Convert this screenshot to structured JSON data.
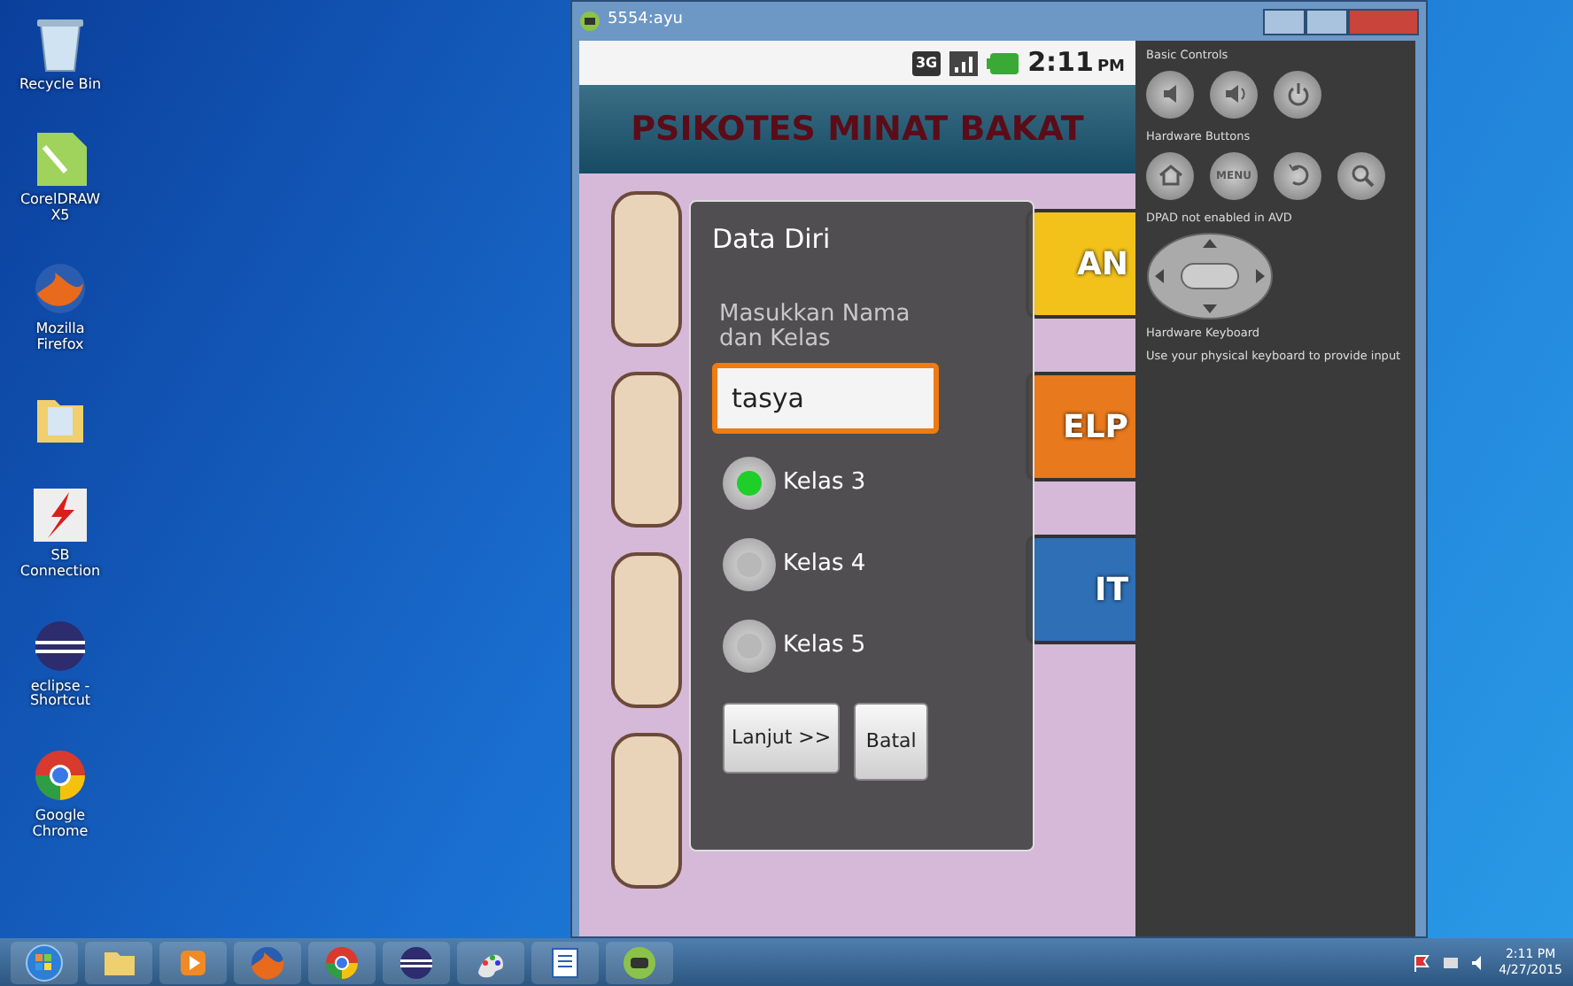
{
  "desktop_icons": [
    {
      "kind": "recycle",
      "label": "Recycle Bin"
    },
    {
      "kind": "corel",
      "label": "CorelDRAW X5"
    },
    {
      "kind": "firefox",
      "label": "Mozilla Firefox"
    },
    {
      "kind": "folder"
    },
    {
      "kind": "flash",
      "label": "SB Connection"
    },
    {
      "kind": "eclipse",
      "label": "eclipse - Shortcut"
    },
    {
      "kind": "chrome",
      "label": "Google Chrome"
    }
  ],
  "emulator": {
    "title": "5554:ayu",
    "status_bar": {
      "network": "3G",
      "time": "2:11",
      "ampm": "PM"
    },
    "app_title": "PSIKOTES MINAT BAKAT",
    "menu_tiles": [
      {
        "label": "AN",
        "color": "#f2c21b"
      },
      {
        "label": "ELP",
        "color": "#e8791c"
      },
      {
        "label": "IT",
        "color": "#2f6fb5"
      }
    ],
    "dialog": {
      "title": "Data Diri",
      "prompt": "Masukkan Nama dan Kelas",
      "name_value": "tasya",
      "options": [
        {
          "label": "Kelas 3",
          "selected": true
        },
        {
          "label": "Kelas 4",
          "selected": false
        },
        {
          "label": "Kelas 5",
          "selected": false
        }
      ],
      "buttons": [
        {
          "label": "Lanjut >>"
        },
        {
          "label": "Batal"
        }
      ]
    },
    "controls": {
      "basic_heading": "Basic Controls",
      "hardware_heading": "Hardware Buttons",
      "menu_key": "MENU",
      "dpad_heading": "DPAD not enabled in AVD",
      "keyboard_heading": "Hardware Keyboard",
      "keyboard_note": "Use your physical keyboard to provide input"
    }
  },
  "tray": {
    "time": "2:11 PM",
    "date": "4/27/2015"
  }
}
